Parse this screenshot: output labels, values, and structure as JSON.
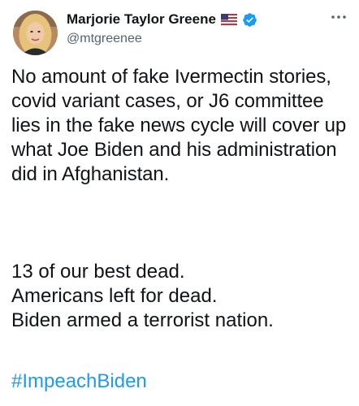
{
  "tweet": {
    "author": {
      "display_name": "Marjorie Taylor Greene",
      "handle": "@mtgreenee",
      "avatar_icon": "profile-photo",
      "flag_icon": "us-flag-emoji",
      "verified_icon": "verified-badge",
      "verified_color": "#1d9bf0"
    },
    "more_icon": "more-options-dots",
    "paragraph1": "No amount of fake Ivermectin stories, covid variant cases, or J6 committee lies in the fake news cycle will cover up what Joe Biden and his administration did in Afghanistan.",
    "paragraph2_lines": [
      "13 of our best dead.",
      "Americans left for dead.",
      "Biden armed a terrorist nation."
    ],
    "hashtag": "#ImpeachBiden",
    "hashtag_color": "#1d9bf0"
  }
}
